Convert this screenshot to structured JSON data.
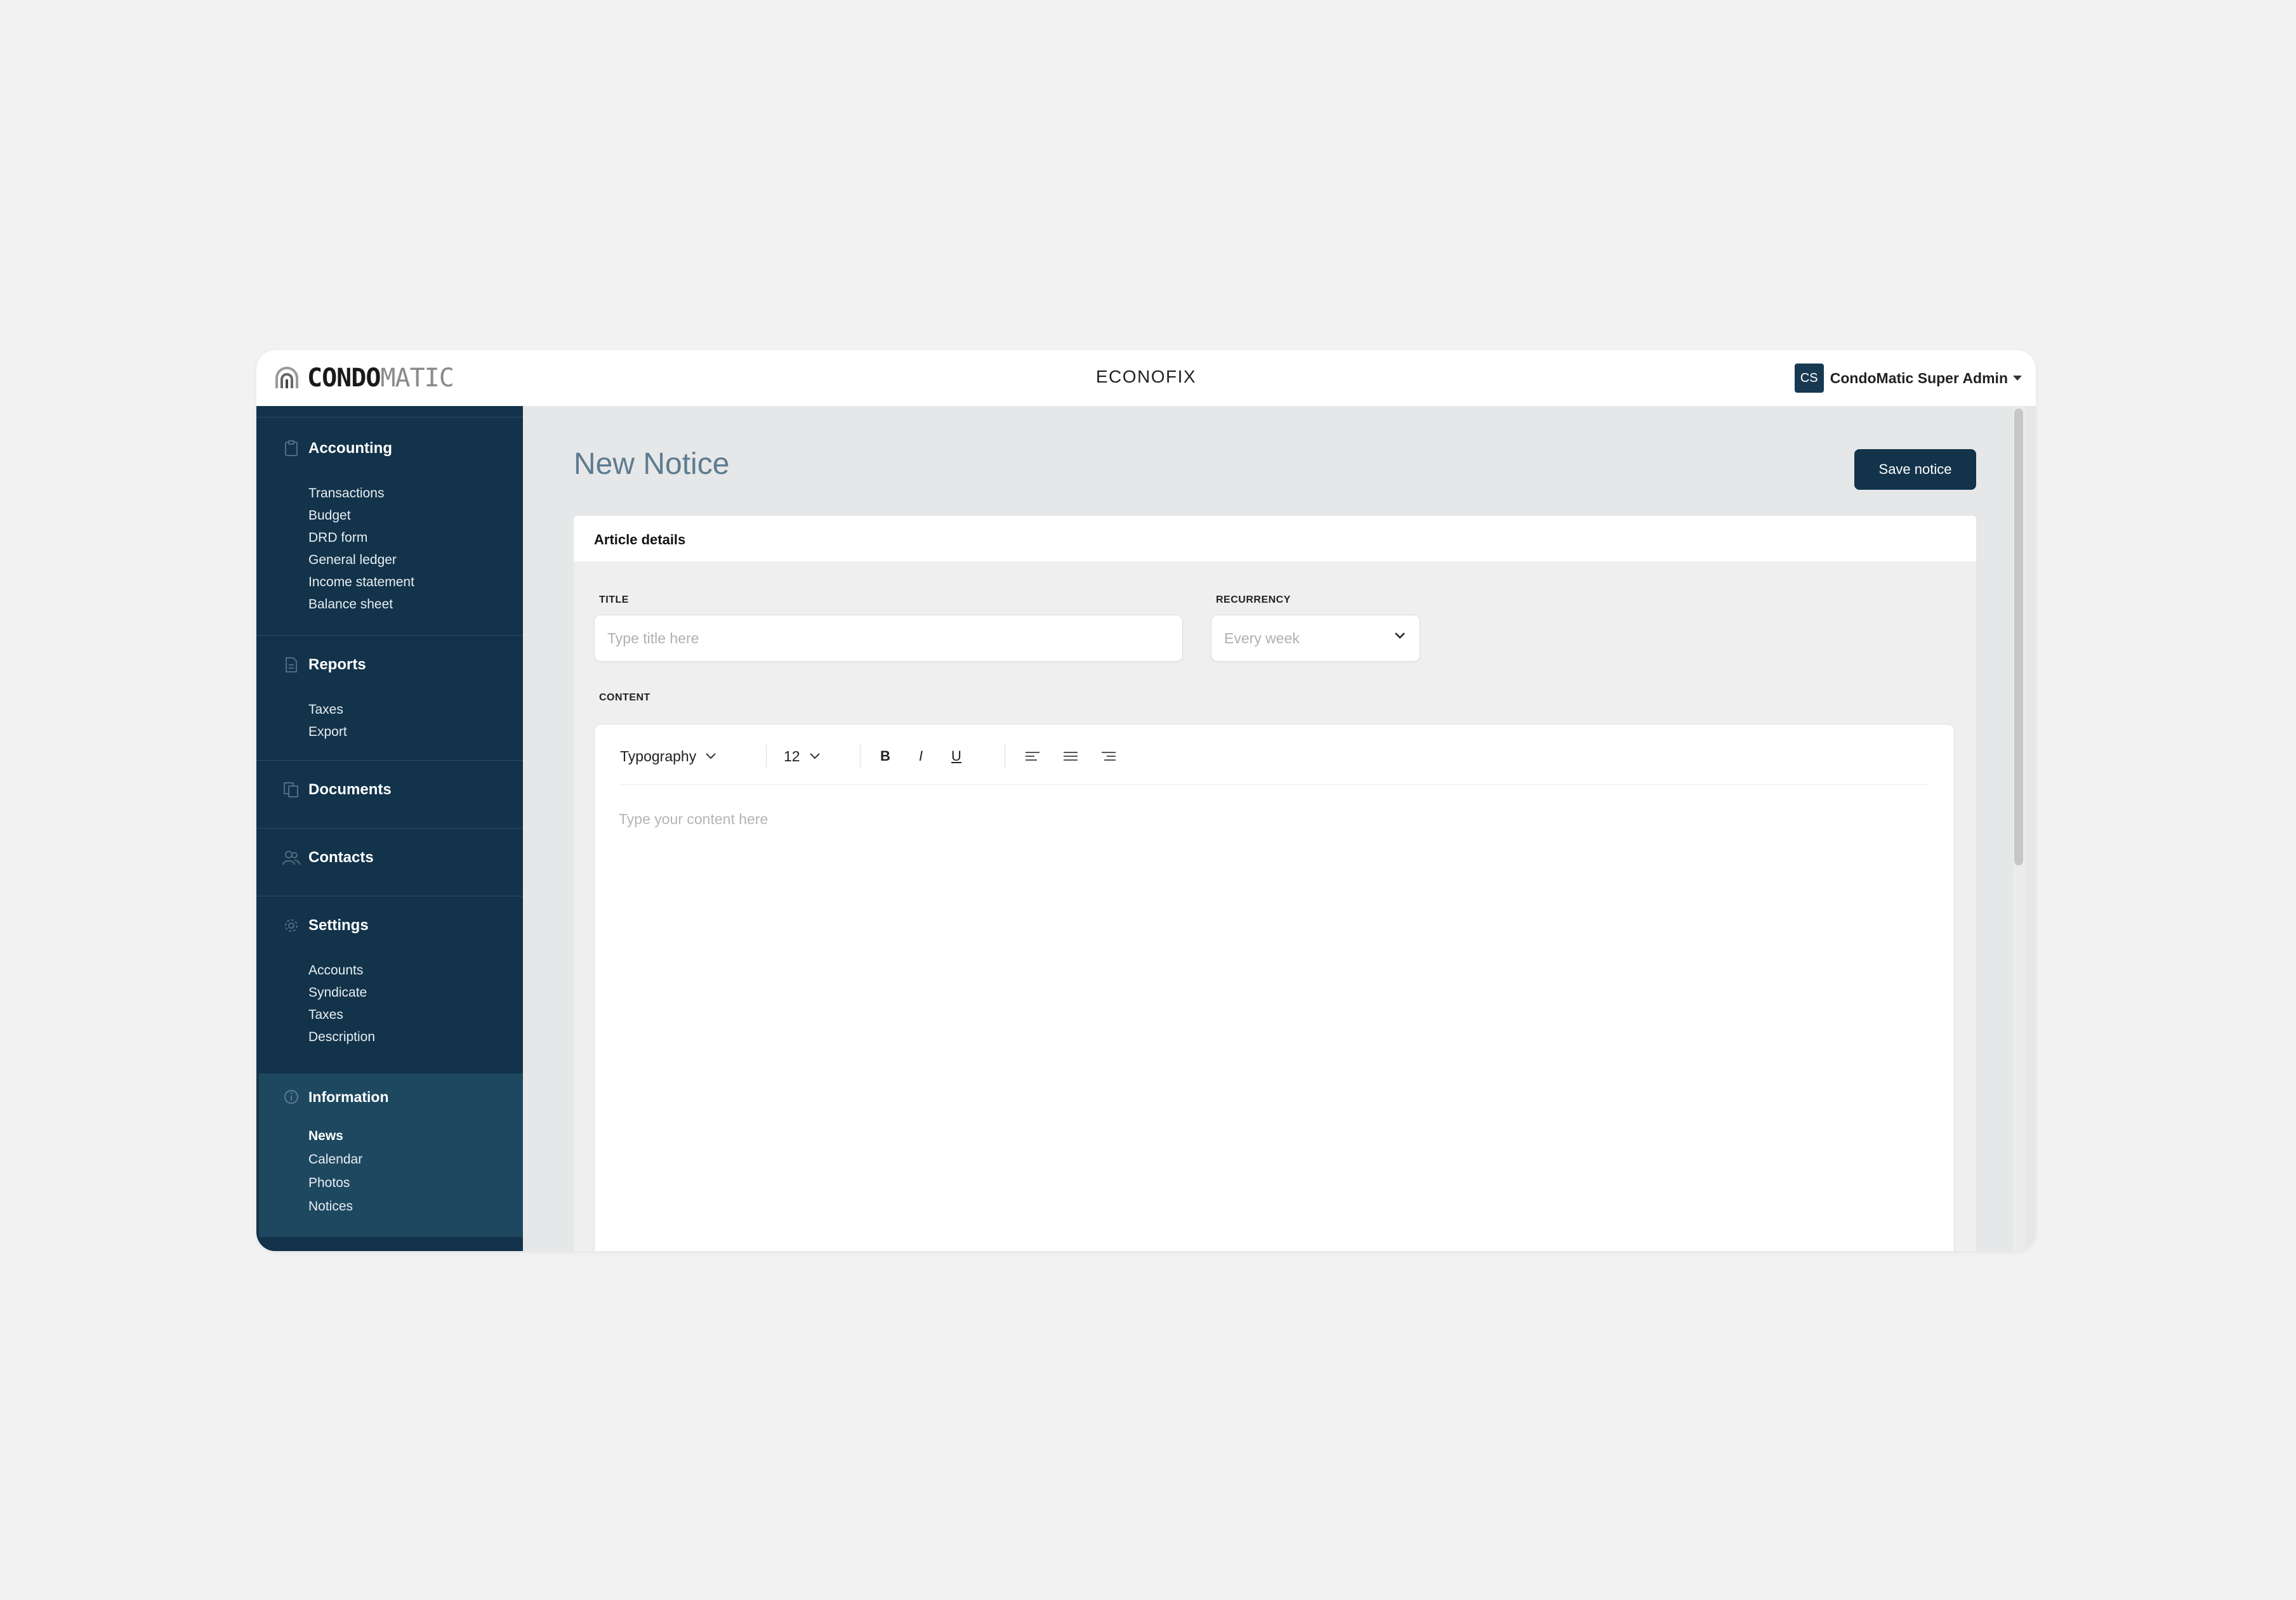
{
  "header": {
    "logo_primary": "CONDO",
    "logo_secondary": "MATIC",
    "app_title": "ECONOFIX",
    "user_initials": "CS",
    "user_name": "CondoMatic Super Admin"
  },
  "sidebar": {
    "sections": [
      {
        "title": "Accounting",
        "icon": "clipboard-icon",
        "items": [
          "Transactions",
          "Budget",
          "DRD form",
          "General ledger",
          "Income statement",
          "Balance sheet"
        ]
      },
      {
        "title": "Reports",
        "icon": "document-icon",
        "items": [
          "Taxes",
          "Export"
        ]
      },
      {
        "title": "Documents",
        "icon": "documents-icon",
        "items": []
      },
      {
        "title": "Contacts",
        "icon": "contacts-icon",
        "items": []
      },
      {
        "title": "Settings",
        "icon": "gear-icon",
        "items": [
          "Accounts",
          "Syndicate",
          "Taxes",
          "Description"
        ]
      },
      {
        "title": "Information",
        "icon": "info-icon",
        "items": [
          "News",
          "Calendar",
          "Photos",
          "Notices"
        ],
        "active_item": "News"
      }
    ]
  },
  "main": {
    "page_title": "New Notice",
    "save_label": "Save notice",
    "card_title": "Article details",
    "title_label": "TITLE",
    "title_placeholder": "Type title here",
    "recurrency_label": "RECURRENCY",
    "recurrency_value": "Every week",
    "content_label": "CONTENT",
    "toolbar": {
      "typography": "Typography",
      "font_size": "12",
      "bold": "B",
      "italic": "I",
      "underline": "U"
    },
    "content_placeholder": "Type your content here"
  },
  "colors": {
    "sidebar_bg": "#12334a",
    "sidebar_active_bg": "#1e4860",
    "accent": "#12334a",
    "title_color": "#5d7c91"
  }
}
